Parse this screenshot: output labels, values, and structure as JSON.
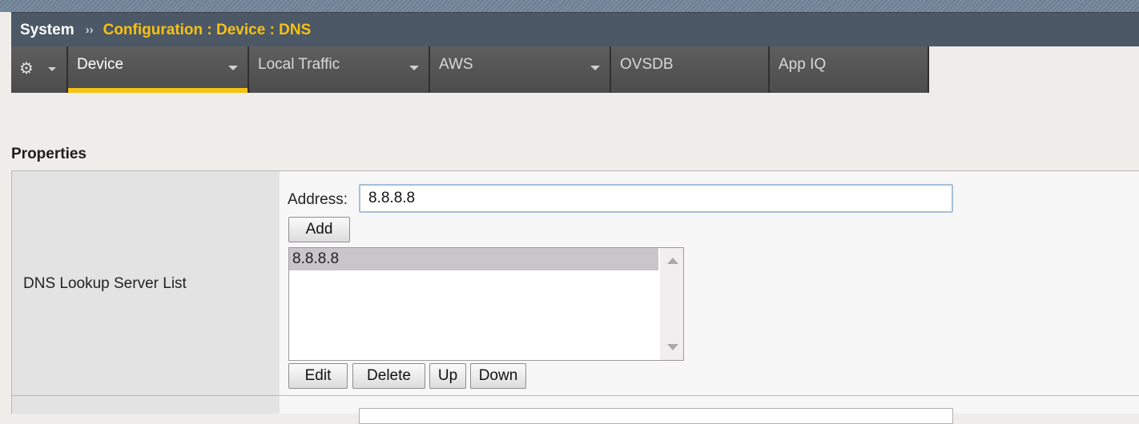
{
  "header": {
    "system_label": "System",
    "separator": "››",
    "current_path": "Configuration : Device : DNS"
  },
  "nav": {
    "settings_icon": "gear-icon",
    "tabs": [
      {
        "label": "Device",
        "has_dropdown": true,
        "active": true
      },
      {
        "label": "Local Traffic",
        "has_dropdown": true,
        "active": false
      },
      {
        "label": "AWS",
        "has_dropdown": true,
        "active": false
      },
      {
        "label": "OVSDB",
        "has_dropdown": false,
        "active": false
      },
      {
        "label": "App IQ",
        "has_dropdown": false,
        "active": false
      }
    ]
  },
  "section": {
    "title": "Properties"
  },
  "dns_lookup": {
    "label": "DNS Lookup Server List",
    "address_label": "Address:",
    "address_value": "8.8.8.8",
    "add_button": "Add",
    "list_items": [
      "8.8.8.8"
    ],
    "selected_item": "8.8.8.8",
    "edit_button": "Edit",
    "delete_button": "Delete",
    "up_button": "Up",
    "down_button": "Down"
  },
  "colors": {
    "accent": "#f7c114",
    "header_bg": "#4c5866",
    "nav_bg": "#555555"
  }
}
